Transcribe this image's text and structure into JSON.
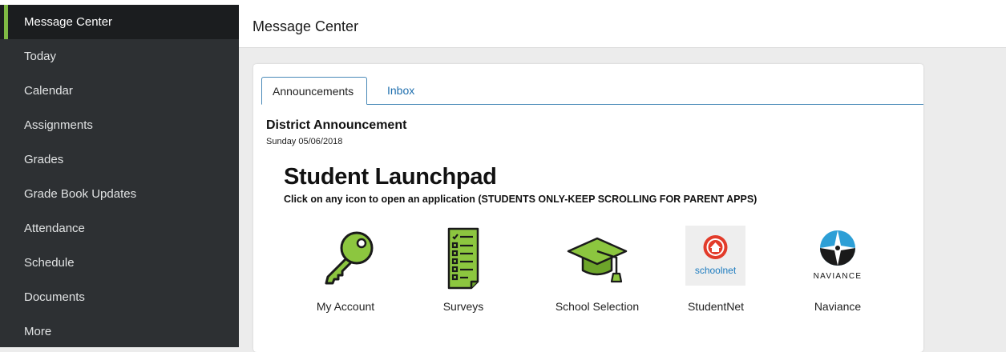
{
  "sidebar": {
    "items": [
      {
        "label": "Message Center",
        "active": true
      },
      {
        "label": "Today"
      },
      {
        "label": "Calendar"
      },
      {
        "label": "Assignments"
      },
      {
        "label": "Grades"
      },
      {
        "label": "Grade Book Updates"
      },
      {
        "label": "Attendance"
      },
      {
        "label": "Schedule"
      },
      {
        "label": "Documents"
      },
      {
        "label": "More"
      }
    ]
  },
  "header": {
    "title": "Message Center"
  },
  "tabs": {
    "announcements": "Announcements",
    "inbox": "Inbox"
  },
  "announcement": {
    "title": "District Announcement",
    "date": "Sunday 05/06/2018",
    "heading": "Student Launchpad",
    "subheading": "Click on any icon to open an application (STUDENTS ONLY-KEEP SCROLLING FOR PARENT APPS)"
  },
  "apps": [
    {
      "label": "My Account",
      "icon": "key-icon"
    },
    {
      "label": "Surveys",
      "icon": "survey-icon"
    },
    {
      "label": "School Selection",
      "icon": "graduation-cap-icon"
    },
    {
      "label": "StudentNet",
      "icon": "schoolnet-logo-icon",
      "logo_text": "schoolnet"
    },
    {
      "label": "Naviance",
      "icon": "naviance-logo-icon",
      "logo_text": "NAVIANCE"
    }
  ],
  "colors": {
    "sidebar_bg": "#2d3033",
    "sidebar_active_bg": "#1b1d1f",
    "sidebar_accent": "#7fb944",
    "link_blue": "#1f6fae",
    "icon_green": "#8cc63f"
  }
}
